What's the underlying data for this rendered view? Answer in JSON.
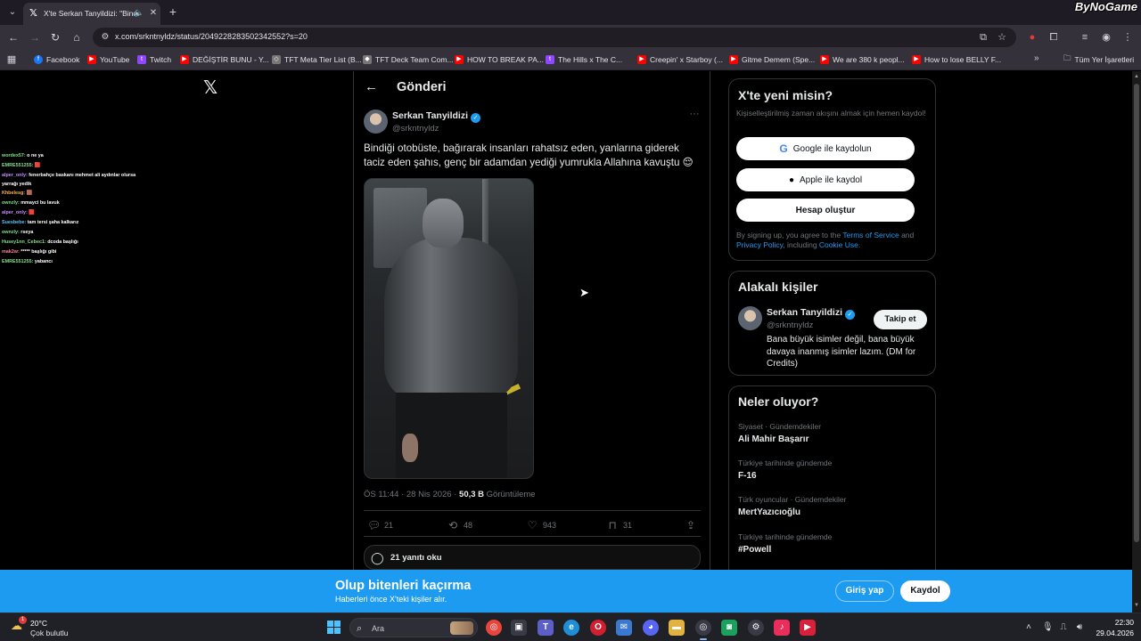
{
  "browser": {
    "tab": {
      "title": "X'te Serkan Tanyildizi: \"Bindi",
      "favicon": "x-logo-icon"
    },
    "url": "x.com/srkntnyldz/status/2049228283502342552?s=20",
    "watermark": "ByNoGame",
    "bookmarks": [
      {
        "label": "Facebook",
        "icon": "facebook-icon"
      },
      {
        "label": "YouTube",
        "icon": "youtube-icon"
      },
      {
        "label": "Twitch",
        "icon": "twitch-icon"
      },
      {
        "label": "DEĞİŞTİR BUNU - Y...",
        "icon": "youtube-icon"
      },
      {
        "label": "TFT Meta Tier List (B...",
        "icon": "tft-icon"
      },
      {
        "label": "TFT Deck Team Com...",
        "icon": "tft-icon"
      },
      {
        "label": "HOW TO BREAK PA...",
        "icon": "youtube-icon"
      },
      {
        "label": "The Hills x The C...",
        "icon": "twitch-icon"
      },
      {
        "label": "Creepin' x Starboy (...",
        "icon": "youtube-icon"
      },
      {
        "label": "Gitme Demem (Spe...",
        "icon": "youtube-icon"
      },
      {
        "label": "We are 380 k peopl...",
        "icon": "youtube-icon"
      },
      {
        "label": "How to lose BELLY F...",
        "icon": "youtube-icon"
      }
    ],
    "all_bookmarks": "Tüm Yer İşaretleri"
  },
  "chat": [
    {
      "user": "wordex57:",
      "msg": " o ne ya"
    },
    {
      "user": "EMRE551255:",
      "msg": " 🟥"
    },
    {
      "user": "alper_only:",
      "msg": " fenerbahçe baskanı mehmet ali aydınlar olursa"
    },
    {
      "user": "",
      "msg": "yarrağı yedik"
    },
    {
      "user": "Khbelesg:",
      "msg": " 🟫"
    },
    {
      "user": "ownzly:",
      "msg": " mmayci bu lavuk"
    },
    {
      "user": "alper_only:",
      "msg": " 🟥"
    },
    {
      "user": "Suesbebe:",
      "msg": " tam tersi şaha kalkarız"
    },
    {
      "user": "ownzly:",
      "msg": " rseya"
    },
    {
      "user": "Husey1nn_Cebec1:",
      "msg": " dcoda başlığı"
    },
    {
      "user": "mak2w:",
      "msg": " ***** başlığı gibi"
    },
    {
      "user": "EMRE551255:",
      "msg": " yabancı"
    }
  ],
  "post": {
    "header_title": "Gönderi",
    "author_name": "Serkan Tanyildizi",
    "author_handle": "@srkntnyldz",
    "text": "Bindiği otobüste, bağırarak insanları rahatsız eden, yanlarına giderek taciz eden şahıs, genç bir adamdan yediği yumrukla Allahına kavuştu 😌",
    "time": "ÖS 11:44 · 28 Nis 2026 · ",
    "views_count": "50,3 B",
    "views_label": " Görüntüleme",
    "replies": "21",
    "reposts": "48",
    "likes": "943",
    "bookmarks": "31",
    "read_replies": "21 yanıtı oku"
  },
  "signup": {
    "title": "X'te yeni misin?",
    "subtitle": "Kişiselleştirilmiş zaman akışını almak için hemen kaydol!",
    "google": "Google ile kaydolun",
    "apple": "Apple ile kaydol",
    "create": "Hesap oluştur",
    "legal_1": "By signing up, you agree to the ",
    "terms": "Terms of Service",
    "legal_2": " and ",
    "privacy": "Privacy Policy",
    "legal_3": ", including ",
    "cookie": "Cookie Use",
    "legal_4": "."
  },
  "related": {
    "title": "Alakalı kişiler",
    "name": "Serkan Tanyildizi",
    "handle": "@srkntnyldz",
    "follow": "Takip et",
    "bio": "Bana büyük isimler değil, bana büyük davaya inanmış isimler lazım. (DM for Credits)"
  },
  "trends": {
    "title": "Neler oluyor?",
    "items": [
      {
        "category": "Siyaset · Gündemdekiler",
        "name": "Ali Mahir Başarır"
      },
      {
        "category": "Türkiye tarihinde gündemde",
        "name": "F-16"
      },
      {
        "category": "Türk oyuncular · Gündemdekiler",
        "name": "MertYazıcıoğlu"
      },
      {
        "category": "Türkiye tarihinde gündemde",
        "name": "#Powell"
      }
    ]
  },
  "banner": {
    "title": "Olup bitenleri kaçırma",
    "subtitle": "Haberleri önce X'teki kişiler alır.",
    "login": "Giriş yap",
    "signup": "Kaydol"
  },
  "taskbar": {
    "temp": "20°C",
    "weather": "Çok bulutlu",
    "weather_badge": "1",
    "search_placeholder": "Ara",
    "time": "22:30",
    "date": "29.04.2026"
  },
  "colors": {
    "accent": "#1d9bf0",
    "background": "#000000",
    "muted": "#71767b"
  }
}
